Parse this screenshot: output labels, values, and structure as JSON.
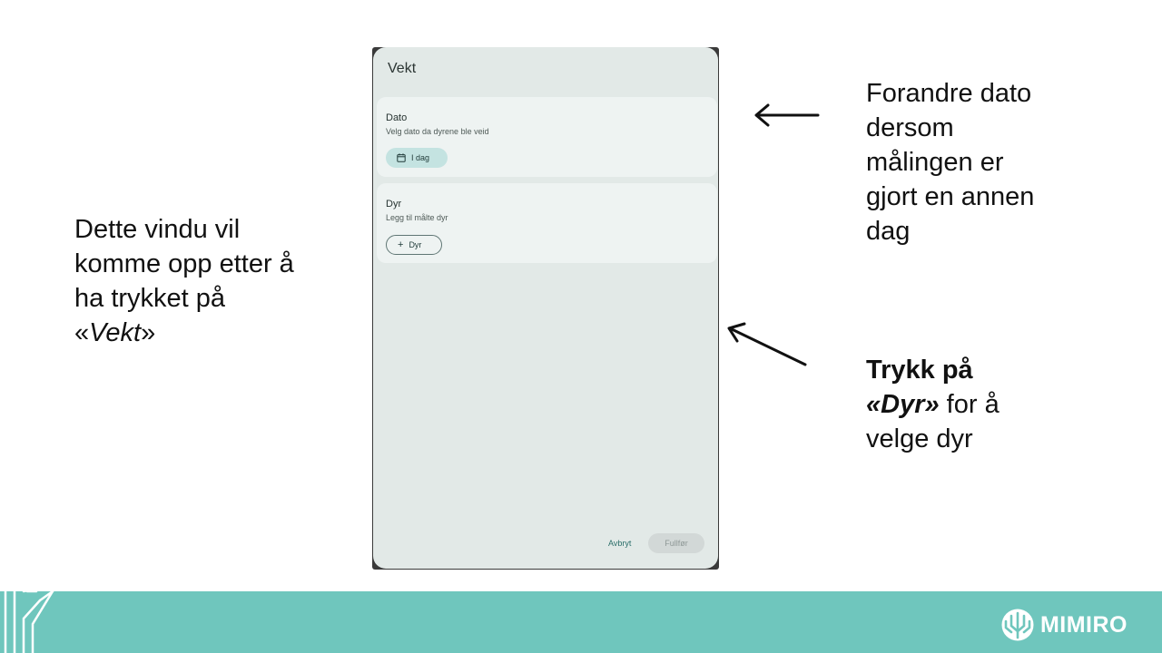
{
  "annotations": {
    "left": {
      "line1": "Dette vindu vil",
      "line2": "komme opp etter å",
      "line3": "ha trykket på",
      "quote_open": "«",
      "quote_word": "Vekt",
      "quote_close": "»"
    },
    "right_top": {
      "line1": "Forandre dato",
      "line2": "dersom",
      "line3": "målingen er",
      "line4": "gjort en annen",
      "line5": "dag"
    },
    "right_bottom": {
      "bold1": "Trykk på",
      "bold_quote": "«Dyr»",
      "rest1": " for å",
      "line3": "velge dyr"
    }
  },
  "dialog": {
    "title": "Vekt",
    "date_card": {
      "title": "Dato",
      "subtitle": "Velg dato da dyrene ble veid",
      "chip_label": "I dag",
      "chip_icon": "calendar-icon"
    },
    "animals_card": {
      "title": "Dyr",
      "subtitle": "Legg til målte dyr",
      "button_label": "Dyr",
      "button_icon": "plus-icon"
    },
    "cancel_label": "Avbryt",
    "finish_label": "Fullfør"
  },
  "footer": {
    "brand": "MIMIRO",
    "color": "#6fc6bd"
  }
}
